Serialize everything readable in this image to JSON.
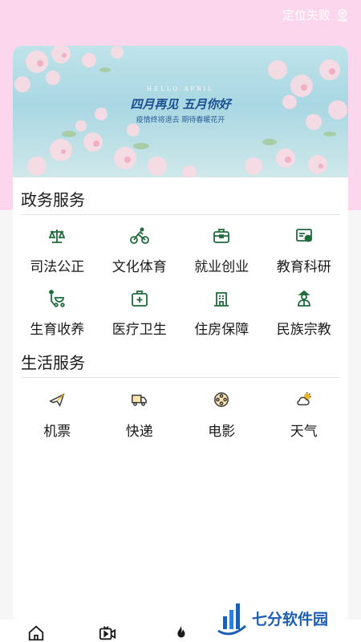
{
  "header": {
    "location_status": "定位失败",
    "location_icon": "location-pin-icon"
  },
  "banner": {
    "small_text": "HELLO APRIL",
    "title": "四月再见 五月你好",
    "subtitle": "疫情终将退去 期待春暖花开"
  },
  "gov_services": {
    "title": "政务服务",
    "items": [
      {
        "label": "司法公正",
        "icon": "scales-icon"
      },
      {
        "label": "文化体育",
        "icon": "cyclist-icon"
      },
      {
        "label": "就业创业",
        "icon": "briefcase-icon"
      },
      {
        "label": "教育科研",
        "icon": "certificate-icon"
      },
      {
        "label": "生育收养",
        "icon": "stroller-icon"
      },
      {
        "label": "医疗卫生",
        "icon": "medical-kit-icon"
      },
      {
        "label": "住房保障",
        "icon": "building-icon"
      },
      {
        "label": "民族宗教",
        "icon": "person-icon"
      }
    ]
  },
  "life_services": {
    "title": "生活服务",
    "items": [
      {
        "label": "机票",
        "icon": "airplane-icon"
      },
      {
        "label": "快递",
        "icon": "delivery-truck-icon"
      },
      {
        "label": "电影",
        "icon": "film-reel-icon"
      },
      {
        "label": "天气",
        "icon": "cloud-sun-icon"
      }
    ]
  },
  "watermark": {
    "text": "七分软件园"
  },
  "colors": {
    "top_background": "#fbd6ec",
    "gov_icon_green": "#1f6b3a",
    "life_icon_dark": "#3a3a3a",
    "life_icon_accent": "#f1b21c"
  }
}
